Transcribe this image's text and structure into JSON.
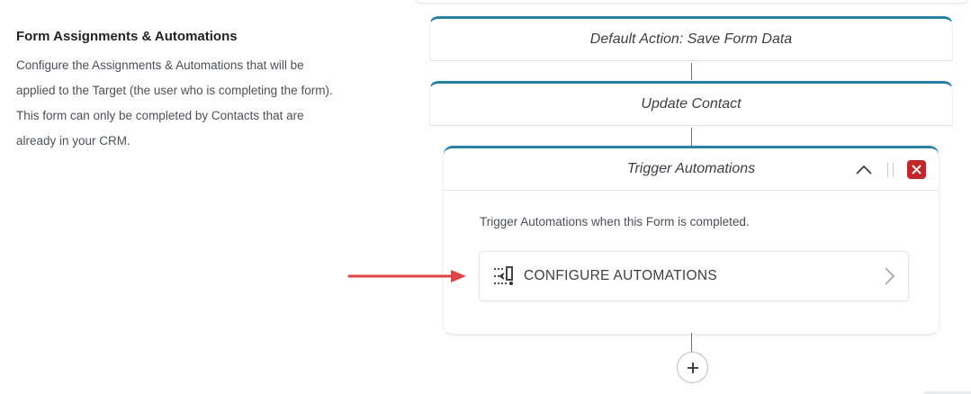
{
  "section": {
    "title": "Form Assignments & Automations",
    "description_lines": [
      "Configure the Assignments & Automations that will be",
      "applied to the Target (the user who is completing the form).",
      "This form can only be completed by Contacts that are",
      "already in your CRM."
    ]
  },
  "flow": {
    "steps": [
      {
        "label": "Default Action: Save Form Data"
      },
      {
        "label": "Update Contact"
      }
    ],
    "panel": {
      "title": "Trigger Automations",
      "description": "Trigger Automations when this Form is completed.",
      "configure_label": "CONFIGURE AUTOMATIONS",
      "configure_icon": "automation-icon",
      "collapse_icon": "chevron-up-icon",
      "drag_icon": "drag-handle-icon",
      "close_icon": "close-icon"
    },
    "add_icon": "plus-icon"
  },
  "colors": {
    "accent": "#2a7fa5",
    "danger": "#c0272d",
    "annotation_arrow": "#e04545"
  }
}
